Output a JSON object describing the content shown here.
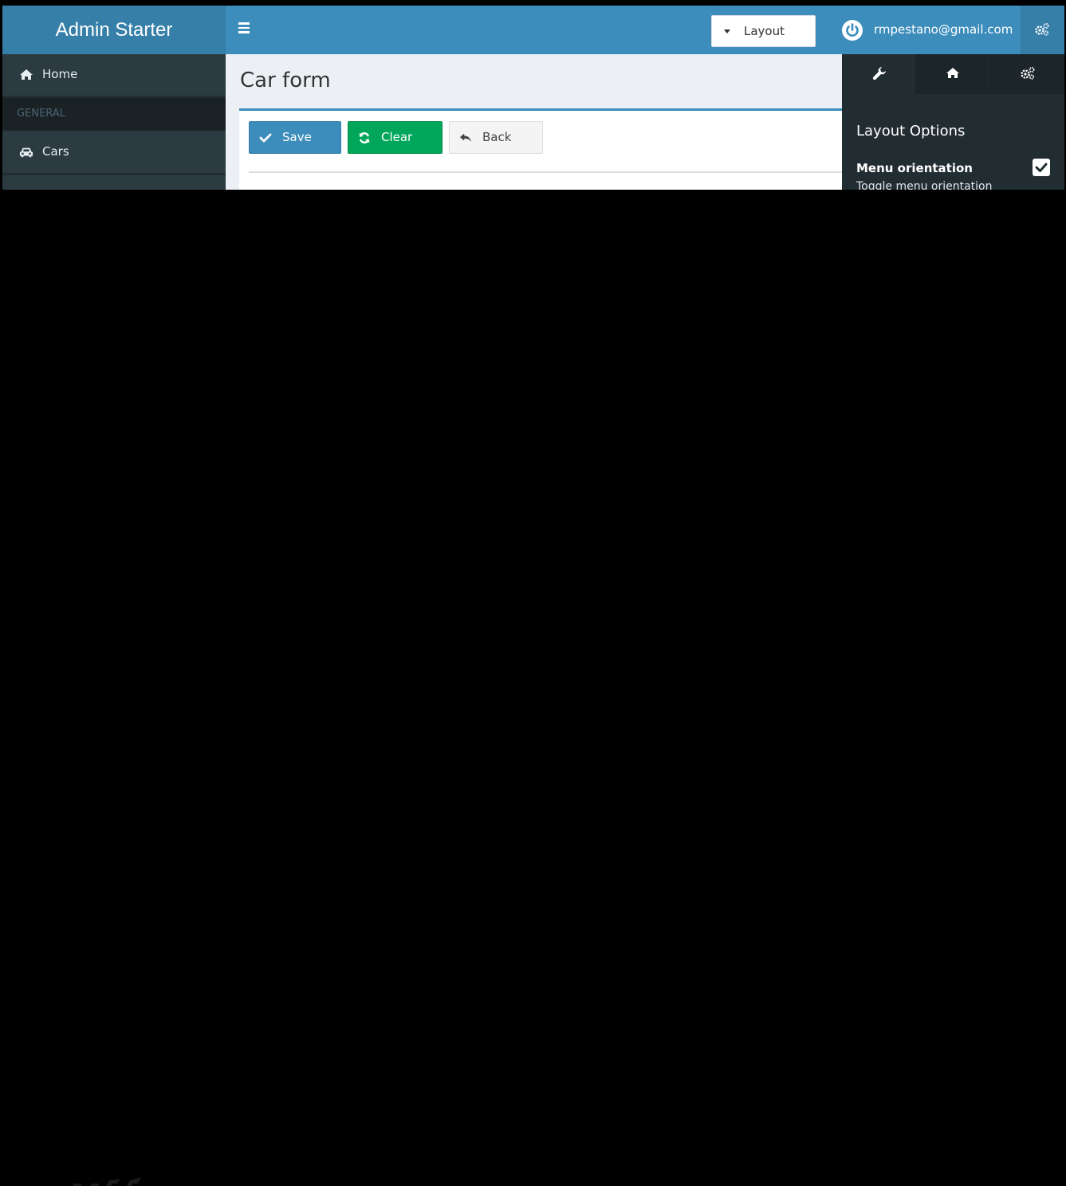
{
  "header": {
    "brand": "Admin Starter",
    "layout_button": "Layout",
    "user_email": "rmpestano@gmail.com",
    "icons": [
      "menu-icon",
      "caret-down-icon",
      "power-icon",
      "gears-icon"
    ]
  },
  "sidebar": {
    "items": [
      {
        "label": "Home",
        "icon": "home-icon"
      },
      {
        "label": "Cars",
        "icon": "car-icon"
      }
    ],
    "section_header": "GENERAL"
  },
  "main": {
    "title": "Car form",
    "buttons": {
      "save": "Save",
      "clear": "Clear",
      "back": "Back"
    }
  },
  "control_sidebar": {
    "tabs": [
      "wrench-icon",
      "home-icon",
      "gears-icon"
    ],
    "heading": "Layout Options",
    "option_label": "Menu orientation",
    "option_checked": true,
    "option_description": "Toggle menu orientation"
  },
  "colors": {
    "header_blue": "#3c8dbc",
    "logo_blue": "#367fa9",
    "sidebar_dark": "#222d32",
    "save_blue": "#3c8dbc",
    "clear_green": "#00a65a"
  }
}
